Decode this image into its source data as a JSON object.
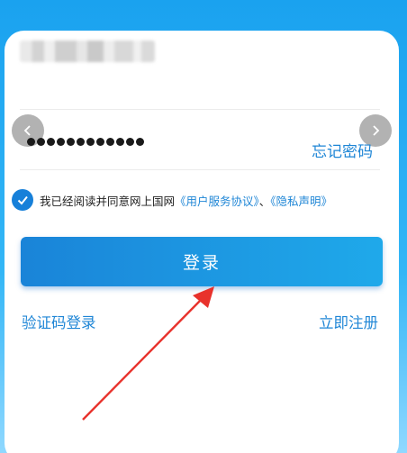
{
  "colors": {
    "accent": "#1f86d6",
    "button_start": "#1a84d8",
    "button_end": "#1fa9ea",
    "annotation_arrow": "#e8322c"
  },
  "form": {
    "username_value": "",
    "password_mask": "●●●●●●●●●●●●",
    "forgot_password_label": "忘记密码"
  },
  "agreement": {
    "checked": true,
    "prefix": "我已经阅读并同意网上国网",
    "user_agreement": "《用户服务协议》",
    "separator": "、",
    "privacy_policy": "《隐私声明》"
  },
  "actions": {
    "login_label": "登录",
    "sms_login_label": "验证码登录",
    "register_label": "立即注册"
  },
  "icons": {
    "nav_left": "chevron-left-icon",
    "nav_right": "chevron-right-icon",
    "checkbox": "checkmark-icon",
    "annotation": "red-arrow-icon"
  }
}
